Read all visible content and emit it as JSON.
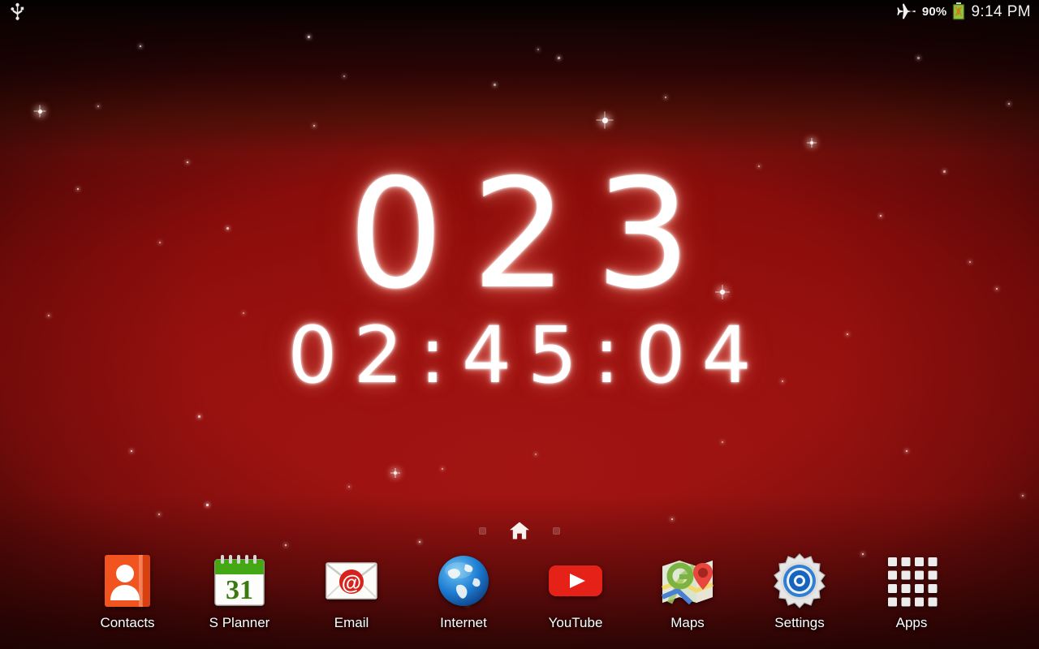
{
  "status_bar": {
    "usb_icon": "usb-icon",
    "airplane_icon": "airplane-mode-icon",
    "battery_percent": "90%",
    "battery_icon": "battery-charging-icon",
    "clock": "9:14 PM"
  },
  "widget": {
    "name": "countdown-timer-widget",
    "days": "023",
    "time": "02:45:04"
  },
  "page_indicator": {
    "home_icon": "home-icon",
    "dots": [
      "",
      ""
    ]
  },
  "dock": {
    "items": [
      {
        "label": "Contacts",
        "icon": "contacts-icon"
      },
      {
        "label": "S Planner",
        "icon": "calendar-icon",
        "day": "31"
      },
      {
        "label": "Email",
        "icon": "email-icon",
        "glyph": "@"
      },
      {
        "label": "Internet",
        "icon": "globe-icon"
      },
      {
        "label": "YouTube",
        "icon": "youtube-icon"
      },
      {
        "label": "Maps",
        "icon": "maps-icon"
      },
      {
        "label": "Settings",
        "icon": "gear-icon"
      },
      {
        "label": "Apps",
        "icon": "apps-grid-icon"
      }
    ]
  },
  "colors": {
    "wallpaper_red": "#8e1110",
    "wallpaper_deep": "#4a0707",
    "status_bar_bg": "#070101",
    "sparkle_white": "#ffffff",
    "contacts_orange": "#f2541f",
    "calendar_green": "#43a814",
    "email_red": "#d8221c",
    "internet_blue": "#1a74c6",
    "youtube_red": "#e62117",
    "settings_blue": "#1565c0",
    "battery_green": "#8cc63e"
  }
}
